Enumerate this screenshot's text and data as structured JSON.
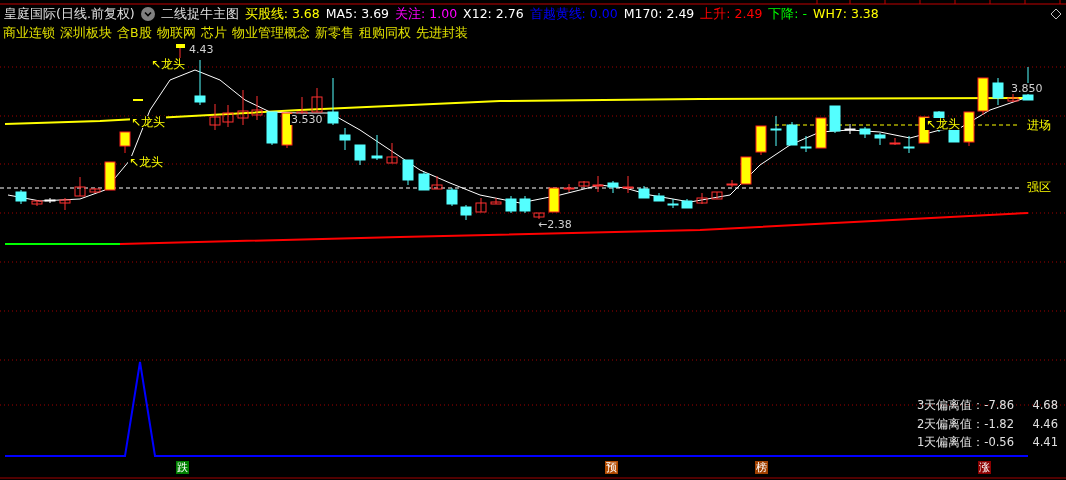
{
  "header": {
    "stock": "皇庭国际(日线.前复权)",
    "indicator": "二线捉牛主图",
    "values": [
      {
        "text": "买股线: 3.68",
        "color": "#ffff00"
      },
      {
        "text": "MA5: 3.69",
        "color": "#ffffff"
      },
      {
        "text": "关注: 1.00",
        "color": "#ff00ff"
      },
      {
        "text": "X12: 2.76",
        "color": "#ffffff"
      },
      {
        "text": "首越黄线: 0.00",
        "color": "#0000ff"
      },
      {
        "text": "M170: 2.49",
        "color": "#ffffff"
      },
      {
        "text": "上升: 2.49",
        "color": "#ff0000"
      },
      {
        "text": "下降: -",
        "color": "#00ff00"
      },
      {
        "text": "WH7: 3.38",
        "color": "#ffff00"
      }
    ]
  },
  "tags": [
    "商业连锁",
    "深圳板块",
    "含B股",
    "物联网",
    "芯片",
    "物业管理概念",
    "新零售",
    "租购同权",
    "先进封装"
  ],
  "chart": {
    "signals": [
      "↖龙头",
      "↖龙头",
      "↖龙头",
      "↖龙头"
    ],
    "prices": [
      "4.43",
      "3.530",
      "←2.38",
      "3.850"
    ],
    "zones": [
      "进场",
      "强区"
    ]
  },
  "deviations": [
    {
      "label": "3天偏离值：-7.86",
      "value": "4.68"
    },
    {
      "label": "2天偏离值：-1.82",
      "value": "4.46"
    },
    {
      "label": "1天偏离值：-0.56",
      "value": "4.41"
    }
  ],
  "markers": [
    {
      "text": "跌",
      "color": "#008000"
    },
    {
      "text": "预",
      "color": "#b04a00"
    },
    {
      "text": "榜",
      "color": "#a04000"
    },
    {
      "text": "涨",
      "color": "#8b0000"
    }
  ]
}
